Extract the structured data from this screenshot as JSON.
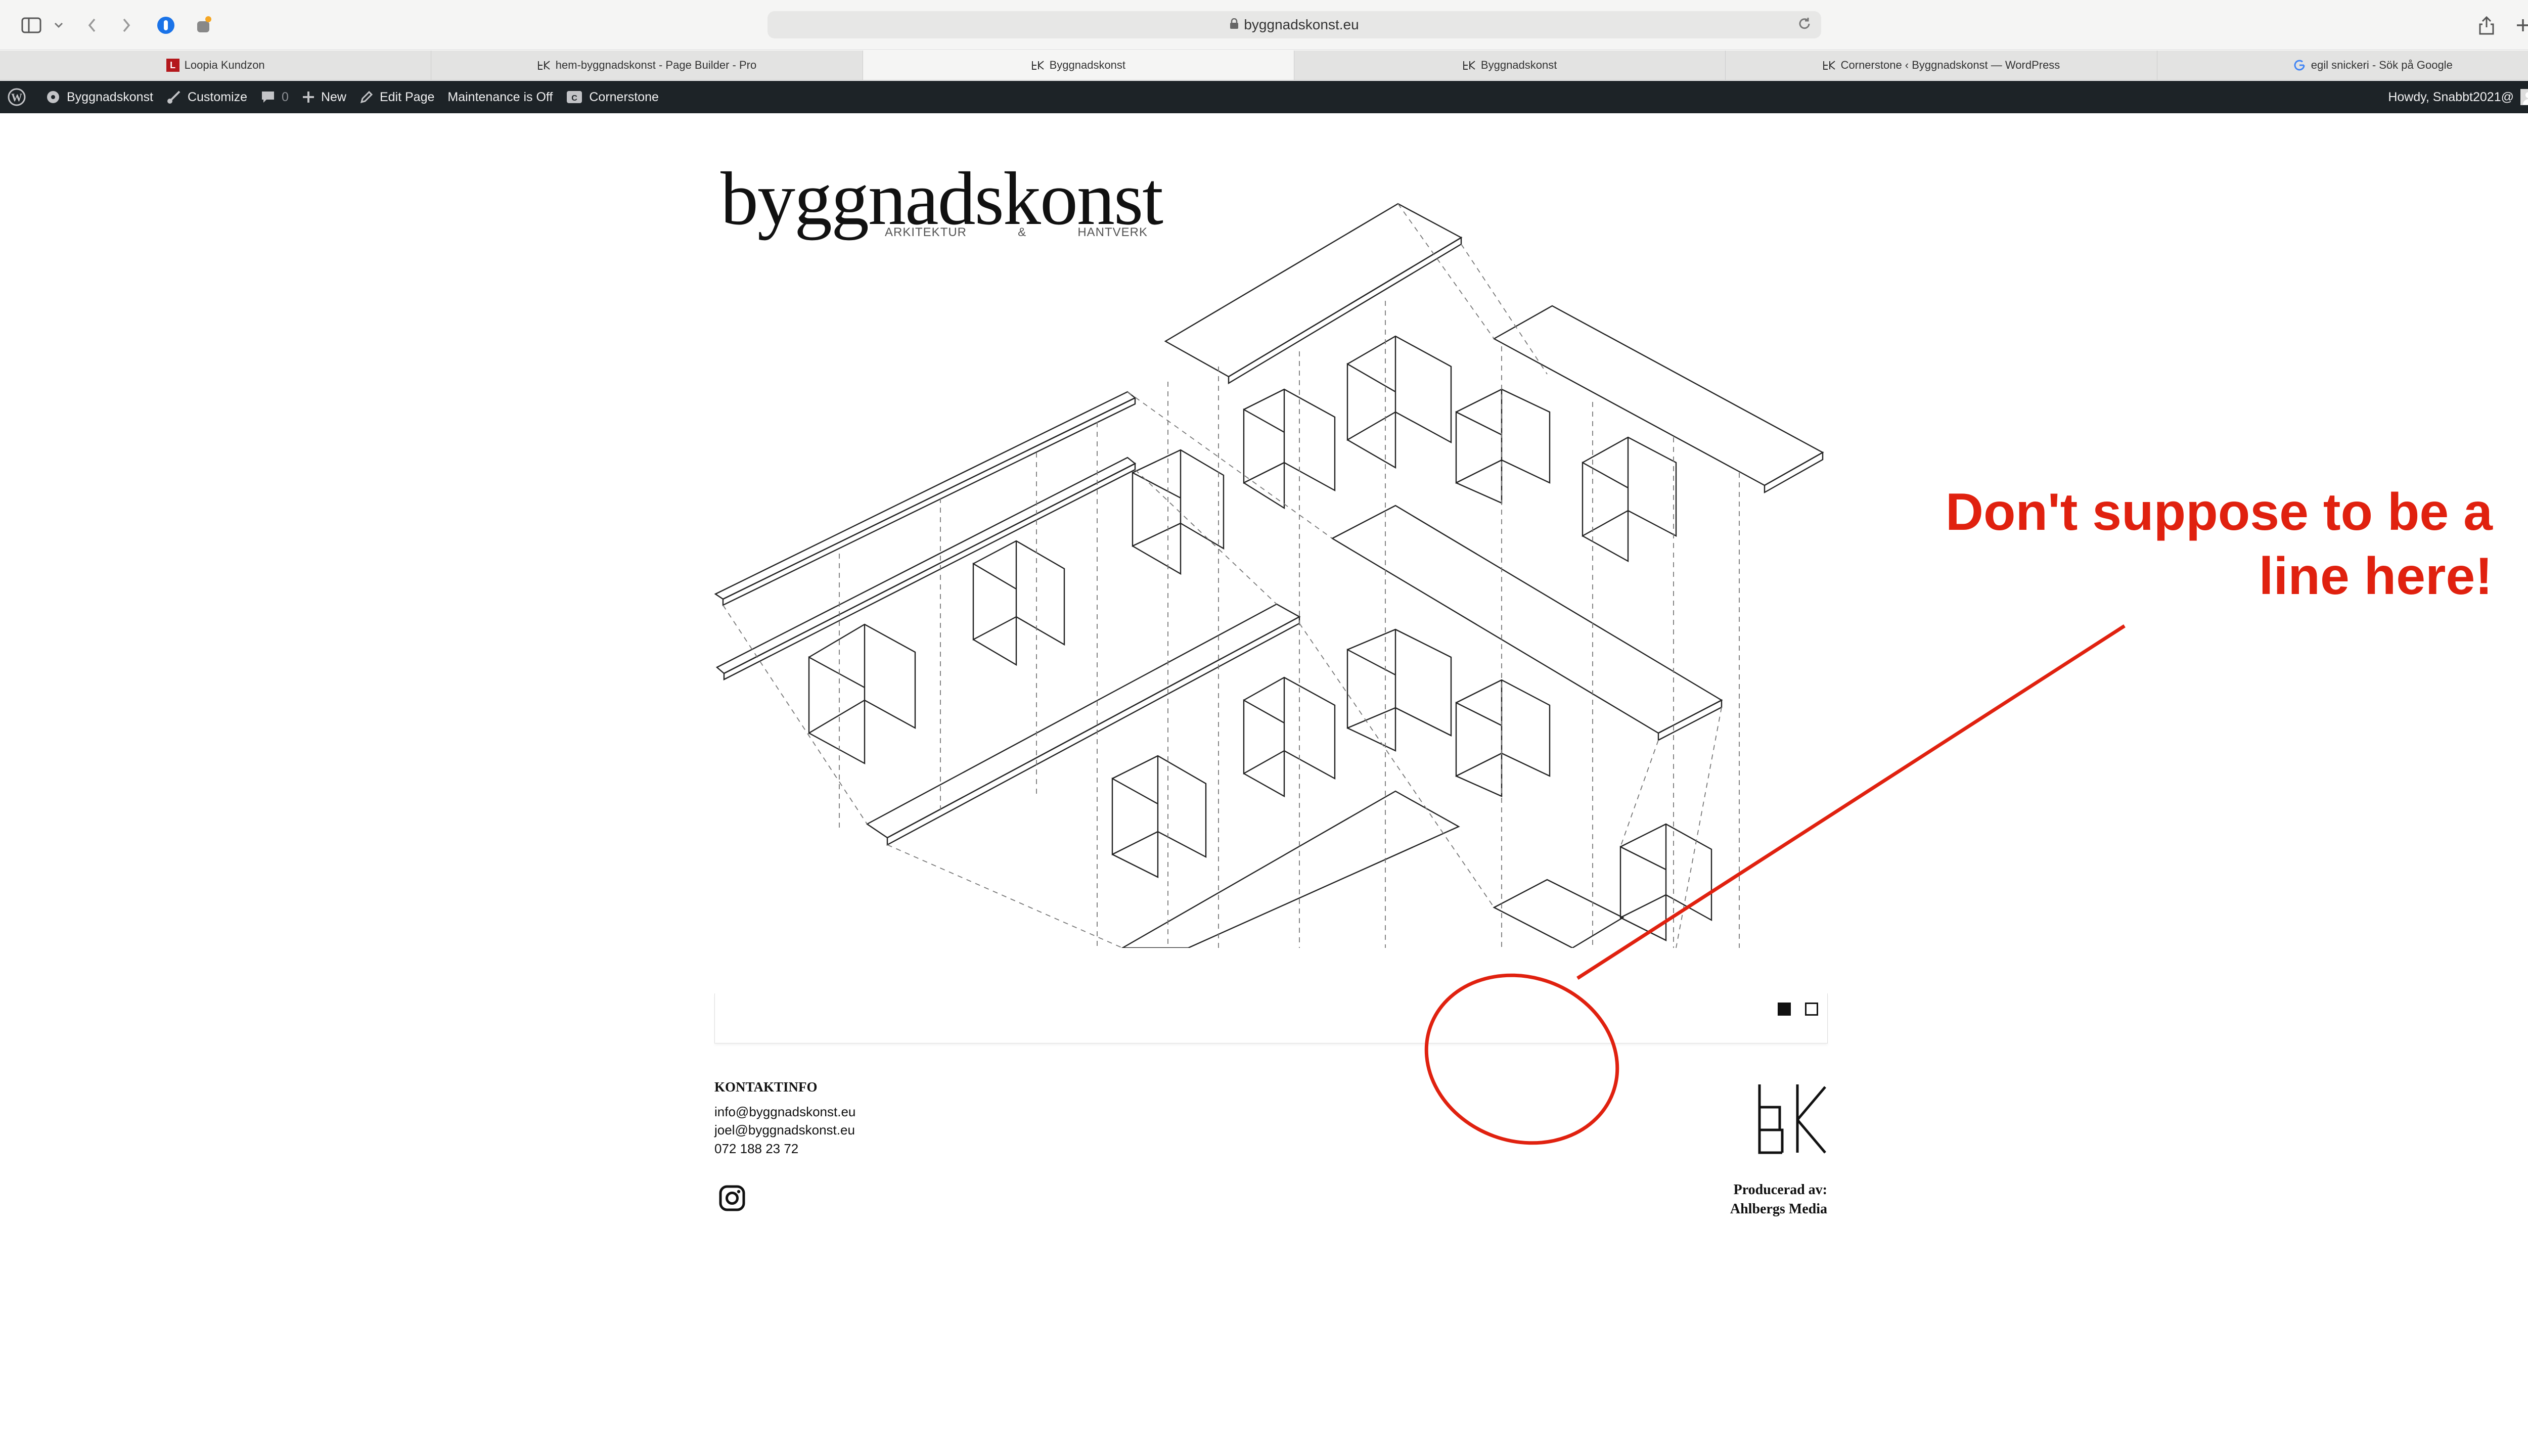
{
  "browser": {
    "url": "byggnadskonst.eu",
    "tabs": [
      {
        "label": "Loopia Kundzon",
        "active": false
      },
      {
        "label": "hem-byggnadskonst - Page Builder - Pro",
        "active": false
      },
      {
        "label": "Byggnadskonst",
        "active": true
      },
      {
        "label": "Byggnadskonst",
        "active": false
      },
      {
        "label": "Cornerstone ‹ Byggnadskonst — WordPress",
        "active": false
      },
      {
        "label": "egil snickeri - Sök på Google",
        "active": false
      }
    ]
  },
  "adminbar": {
    "site": "Byggnadskonst",
    "customize": "Customize",
    "comments": "0",
    "new": "New",
    "edit_page": "Edit Page",
    "maintenance": "Maintenance is Off",
    "cornerstone": "Cornerstone",
    "howdy": "Howdy, Snabbt2021@"
  },
  "page": {
    "logo_title": "byggnadskonst",
    "logo_sub": [
      "ARKITEKTUR",
      "&",
      "HANTVERK"
    ],
    "contact": {
      "title": "KONTAKTINFO",
      "lines": [
        "info@byggnadskonst.eu",
        "joel@byggnadskonst.eu",
        "072 188 23 72"
      ]
    },
    "producer": {
      "line1": "Producerad av:",
      "line2": "Ahlbergs Media"
    }
  },
  "annotation": {
    "text_line1": "Don't suppose to be a",
    "text_line2": "line here!",
    "color": "#e0210f"
  }
}
